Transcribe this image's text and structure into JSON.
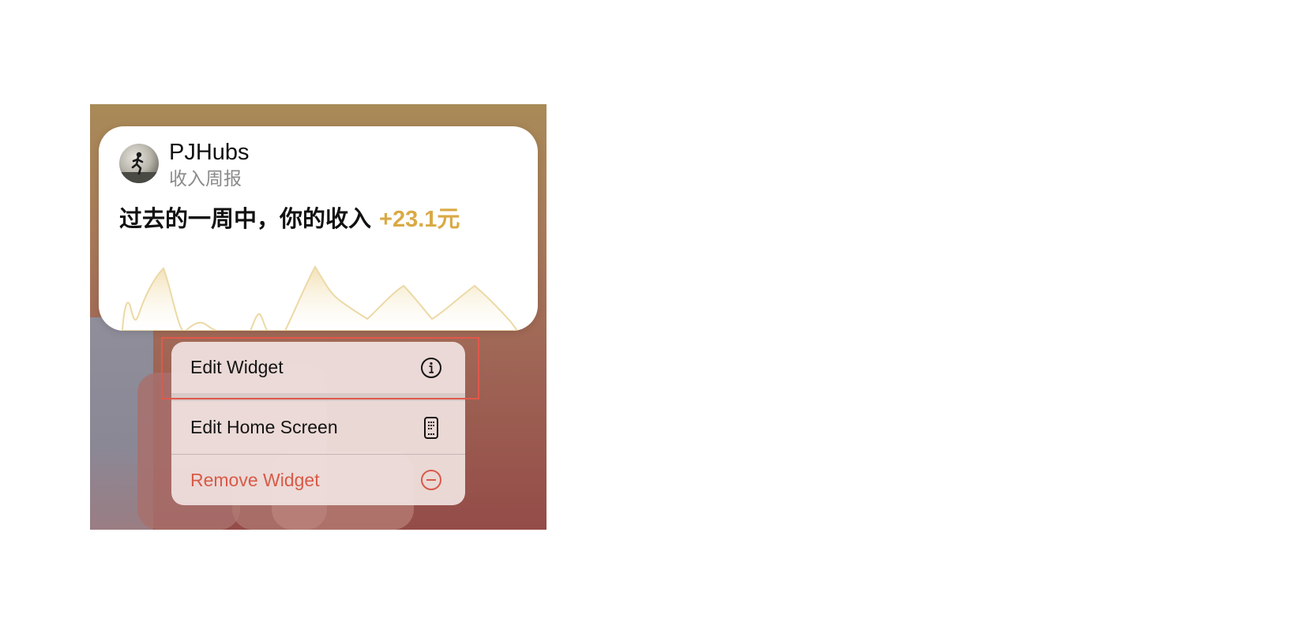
{
  "widget": {
    "app_name": "PJHubs",
    "subtitle": "收入周报",
    "summary_text": "过去的一周中，你的收入",
    "amount": "+23.1元",
    "accent_color": "#d9aa45"
  },
  "menu": {
    "items": [
      {
        "label": "Edit Widget",
        "icon": "info-circle-icon"
      },
      {
        "label": "Edit Home Screen",
        "icon": "phone-apps-icon"
      },
      {
        "label": "Remove Widget",
        "icon": "minus-circle-icon",
        "color": "#d85a47"
      }
    ]
  },
  "highlight_color": "#e0584c"
}
